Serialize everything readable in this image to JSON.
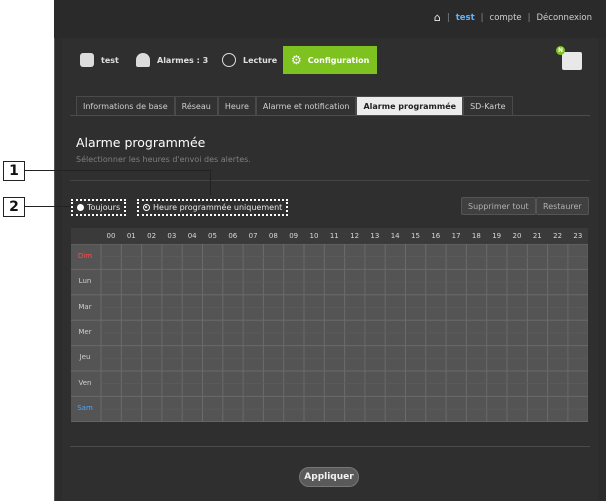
{
  "header": {
    "home_icon": "home-icon",
    "user": "test",
    "sep1": "|",
    "account": "compte",
    "sep2": "|",
    "logout": "Déconnexion"
  },
  "nav": {
    "camera": "test",
    "alarms": "Alarmes : 3",
    "playback": "Lecture",
    "config": "Configuration",
    "badge": "N"
  },
  "tabs": [
    "Informations de base",
    "Réseau",
    "Heure",
    "Alarme et notification",
    "Alarme programmée",
    "SD-Karte"
  ],
  "page": {
    "title": "Alarme programmée",
    "subtitle": "Sélectionner les heures d'envoi des alertes."
  },
  "options": {
    "always": "Toujours",
    "scheduled": "Heure programmée uniquement",
    "selected": "scheduled"
  },
  "actions": {
    "delete_all": "Supprimer tout",
    "restore": "Restaurer",
    "apply": "Appliquer"
  },
  "grid": {
    "hours": [
      "00",
      "01",
      "02",
      "03",
      "04",
      "05",
      "06",
      "07",
      "08",
      "09",
      "10",
      "11",
      "12",
      "13",
      "14",
      "15",
      "16",
      "17",
      "18",
      "19",
      "20",
      "21",
      "22",
      "23"
    ],
    "days": [
      "Dim",
      "Lun",
      "Mar",
      "Mer",
      "Jeu",
      "Ven",
      "Sam"
    ],
    "colors": {
      "sunday": "#ff4d4d",
      "saturday": "#4da6ff"
    }
  },
  "callouts": {
    "one": "1",
    "two": "2"
  }
}
